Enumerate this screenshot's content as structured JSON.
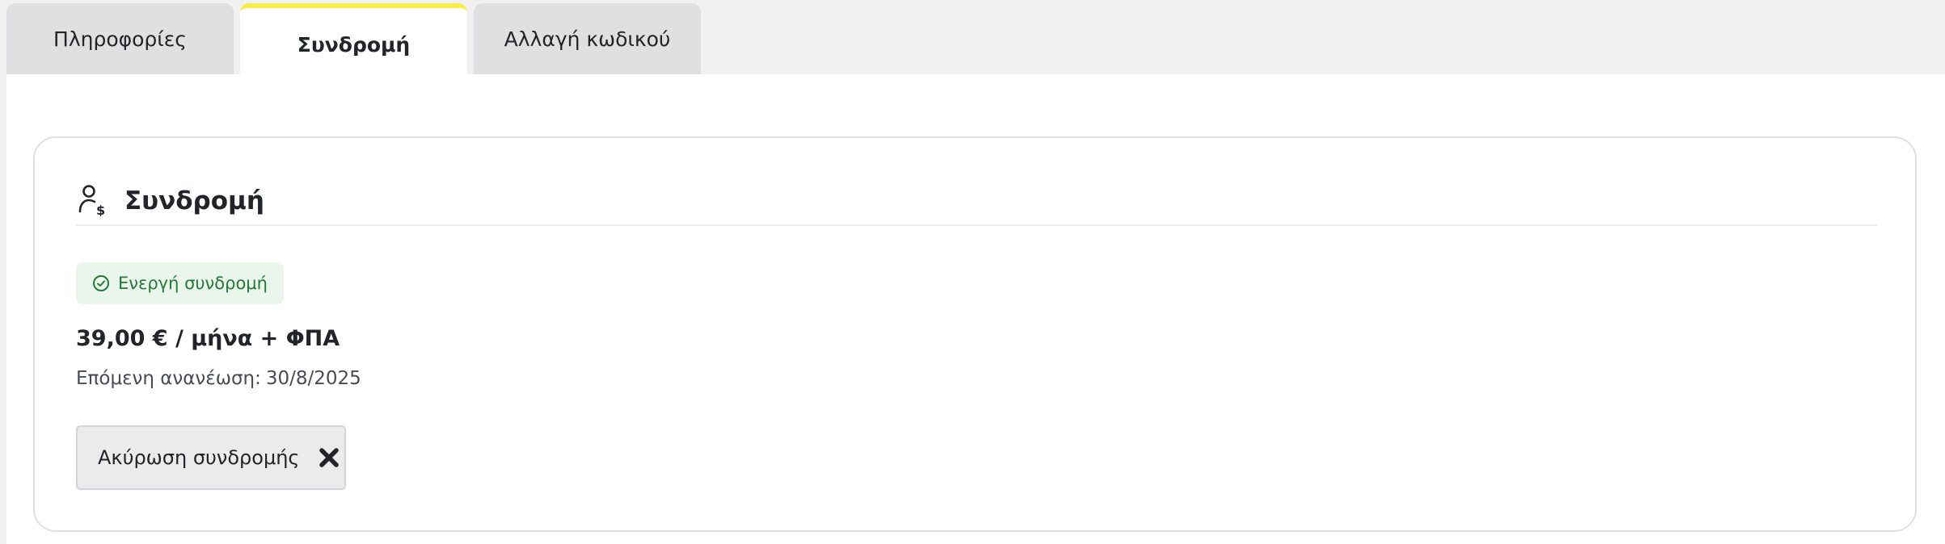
{
  "tabs": [
    {
      "label": "Πληροφορίες",
      "active": false
    },
    {
      "label": "Συνδρομή",
      "active": true
    },
    {
      "label": "Αλλαγή κωδικού",
      "active": false
    }
  ],
  "card": {
    "title": "Συνδρομή",
    "icon": "user-dollar-icon",
    "status": {
      "label": "Ενεργή συνδρομή",
      "icon": "check-circle-icon",
      "color": "#257838",
      "background": "#eaf6ec"
    },
    "price": "39,00 € / μήνα + ΦΠΑ",
    "renewal": {
      "label": "Επόμενη ανανέωση:",
      "date": "30/8/2025"
    },
    "cancel_button": {
      "label": "Ακύρωση συνδρομής",
      "icon": "close-x-icon"
    }
  },
  "colors": {
    "active_tab_accent": "#f7ee4a",
    "page_background": "#f1f1f1",
    "inactive_tab": "#e0e0e3"
  }
}
